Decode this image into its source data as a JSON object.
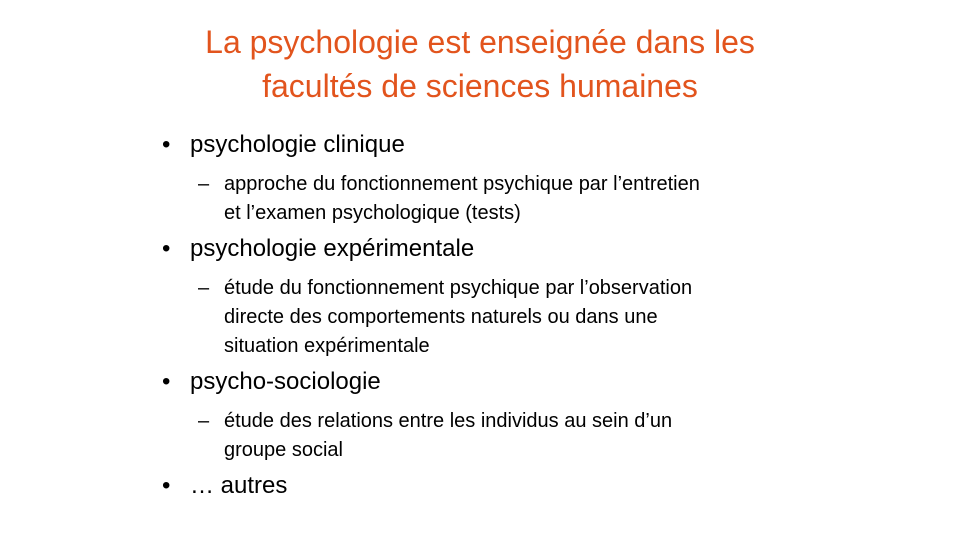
{
  "slide": {
    "title_lines": [
      "La psychologie est enseignée dans les",
      "facultés de sciences humaines"
    ],
    "accent_color": "#e2541d",
    "bullet_marker": "•",
    "sub_marker": "–",
    "items": [
      {
        "label": "psychologie clinique",
        "sub_lines": [
          "approche du fonctionnement psychique par l’entretien",
          "et l’examen psychologique (tests)"
        ]
      },
      {
        "label": "psychologie expérimentale",
        "sub_lines": [
          "étude du fonctionnement psychique par l’observation",
          "directe des comportements naturels ou dans une",
          "situation expérimentale"
        ]
      },
      {
        "label": "psycho-sociologie",
        "sub_lines": [
          "étude des relations entre les individus au sein d’un",
          "groupe social"
        ]
      },
      {
        "label": "… autres"
      }
    ]
  }
}
